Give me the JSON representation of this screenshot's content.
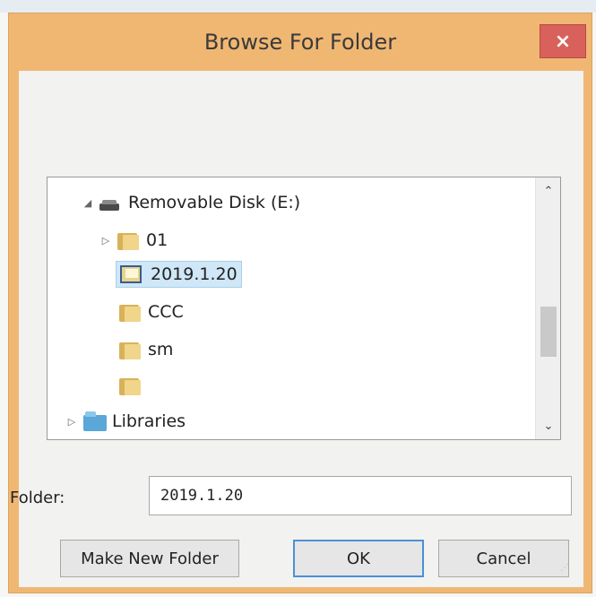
{
  "dialog": {
    "title": "Browse For Folder",
    "close_label": "×"
  },
  "tree": {
    "items": [
      {
        "label": "Removable Disk (E:)",
        "expanded_marker": "◢"
      },
      {
        "label": "01",
        "collapsed_marker": "▷"
      },
      {
        "label": "2019.1.20"
      },
      {
        "label": "CCC"
      },
      {
        "label": "sm"
      },
      {
        "label": ""
      },
      {
        "label": "Libraries",
        "collapsed_marker": "▷"
      }
    ],
    "scroll_up": "⌃",
    "scroll_down": "⌄"
  },
  "folder_field": {
    "label": "Folder:",
    "value": "2019.1.20"
  },
  "buttons": {
    "make_new_folder": "Make New Folder",
    "ok": "OK",
    "cancel": "Cancel"
  },
  "colors": {
    "window_frame": "#f0b773",
    "close_button": "#d9615c",
    "selection": "#cfe7f7",
    "default_button_border": "#4a90d8"
  }
}
